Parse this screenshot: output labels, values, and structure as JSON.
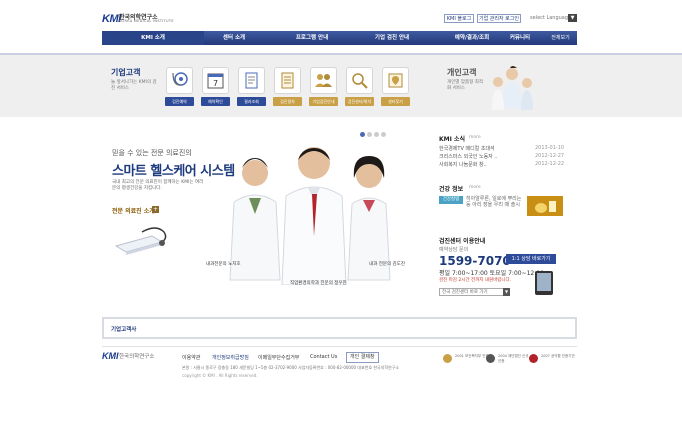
{
  "header": {
    "logo_mark": "KMI",
    "logo_name": "한국의학연구소",
    "logo_sub": "KOREA MEDICAL INSTITUTE",
    "top_buttons": [
      "KMI 블로그",
      "기업 관리자 로그인"
    ],
    "language_label": "select Language"
  },
  "nav": {
    "items": [
      "KMI 소개",
      "센터 소개",
      "프로그램 안내",
      "기업 검진 안내",
      "예약/결과/조회",
      "커뮤니티"
    ],
    "sitemap": "전체보기"
  },
  "services": {
    "title": "기업고객",
    "desc": "늘 앞서나가는 KMI의 검진 서비스",
    "items": [
      {
        "label": "검진예약",
        "icon": "stethoscope-icon"
      },
      {
        "label": "예약확인",
        "icon": "calendar-icon"
      },
      {
        "label": "결과조회",
        "icon": "document-icon"
      },
      {
        "label": "검진절차",
        "icon": "checklist-icon"
      },
      {
        "label": "기업검진안내",
        "icon": "group-icon"
      },
      {
        "label": "검진센터/위치",
        "icon": "magnifier-icon"
      },
      {
        "label": "센터찾기",
        "icon": "map-pin-icon"
      }
    ],
    "personal_title": "개인고객",
    "personal_desc": "개인별 맞춤형 최적화 서비스"
  },
  "hero": {
    "subtitle": "믿을 수 있는 전문 의료진의",
    "title": "스마트 헬스케어 시스템",
    "desc": "국내 최고의 전문 의료진이 함께하는 KMI는 여러분의 평생건강을 지킵니다.",
    "intro_link": "전문 의료진 소개",
    "captions": [
      "내과전문의 노지호",
      "직업환경의학과 전문의 정우진",
      "내과 전문의 김도진"
    ]
  },
  "news": {
    "title": "KMI 소식",
    "more": "more",
    "items": [
      {
        "title": "한국경제TV 매디컬 초대석",
        "date": "2013-01-10"
      },
      {
        "title": "크리스마스 외국인 노동자 ..",
        "date": "2012-12-27"
      },
      {
        "title": "사회복지 나눔문화 창..",
        "date": "2012-12-22"
      }
    ]
  },
  "health": {
    "title": "건강 정보",
    "more": "more",
    "tag": "건강칼럼",
    "text": "히아알루론, 일로에 뿌리는 등 아리 장을 우리 때 솔시"
  },
  "center": {
    "title": "검진센터 이용안내",
    "sub": "예약상담 문의",
    "phone": "1599-7070",
    "quick_btn": "1:1 상담 바로가기",
    "hours": "평일 7:00~17:00 토요일 7:00~12:00",
    "note": "검진 마감 2시간 전까지 내원바랍니다.",
    "select": "전국 검진센터 바로 가기"
  },
  "customer": {
    "label": "기업고객사"
  },
  "footer": {
    "logo_mark": "KMI",
    "logo_name": "한국의학연구소",
    "links": [
      "이용약관",
      "개인정보취급방침",
      "이메일무단수집거부",
      "Contact Us",
      "개인 결제창"
    ],
    "address": "본원 : 서울시 종로구 장충동 180 새문빌딩 1~5층  02-3702-9000  사업자등록번호 : 000-82-00000  대표번호 한국의학연구소",
    "copyright": "copyright © KMI . All Rights reserved.",
    "awards": [
      "2001 보건복지부 인증",
      "2004 재단법인 신규 인증",
      "2007 공익활 인증기관"
    ]
  }
}
